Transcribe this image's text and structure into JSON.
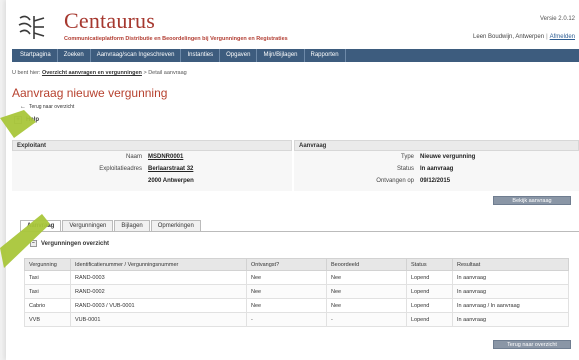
{
  "header": {
    "brand": "Centaurus",
    "tagline": "Communicatieplatform Distributie en Beoordelingen bij Vergunningen en Registraties",
    "version": "Versie 2.0.12",
    "user": "Leen Boudwijn, Antwerpen",
    "logout": "Afmelden"
  },
  "nav": {
    "items": [
      "Startpagina",
      "Zoeken",
      "Aanvraag/scan Ingeschreven",
      "Instanties",
      "Opgaven",
      "Mijn/Bijlagen",
      "Rapporten"
    ]
  },
  "breadcrumb": {
    "prefix": "U bent hier:",
    "link": "Overzicht aanvragen en vergunningen",
    "current": "> Detail aanvraag"
  },
  "page": {
    "title": "Aanvraag nieuwe vergunning",
    "back_link": "Terug naar overzicht",
    "help": "Help"
  },
  "exploitant": {
    "heading": "Exploitant",
    "fields": [
      {
        "key": "Naam",
        "value": "MSDNR0001"
      },
      {
        "key": "Exploitatieadres",
        "value": "Berlaarstraat 32"
      },
      {
        "key": "",
        "value": "2000 Antwerpen"
      }
    ]
  },
  "aanvraag": {
    "heading": "Aanvraag",
    "fields": [
      {
        "key": "Type",
        "value": "Nieuwe vergunning"
      },
      {
        "key": "Status",
        "value": "In aanvraag"
      },
      {
        "key": "Ontvangen op",
        "value": "09/12/2015"
      }
    ],
    "button": "Bekijk aanvraag"
  },
  "tabs": [
    "Aanvraag",
    "Vergunningen",
    "Bijlagen",
    "Opmerkingen"
  ],
  "section": {
    "title": "Vergunningen overzicht"
  },
  "table": {
    "columns": [
      "Vergunning",
      "Identificatienummer / Vergunningsnummer",
      "Ontvangst?",
      "Beoordeeld",
      "Status",
      "Resultaat"
    ],
    "rows": [
      [
        "Taxi",
        "RAND-0003",
        "Nee",
        "Nee",
        "Lopend",
        "In aanvraag"
      ],
      [
        "Taxi",
        "RAND-0002",
        "Nee",
        "Nee",
        "Lopend",
        "In aanvraag"
      ],
      [
        "Cabrio",
        "RAND-0003 / VUB-0001",
        "Nee",
        "Nee",
        "Lopend",
        "In aanvraag / In aanvraag"
      ],
      [
        "VVB",
        "VUB-0001",
        "-",
        "-",
        "Lopend",
        "In aanvraag"
      ]
    ],
    "button": "Terug naar overzicht"
  },
  "colors": {
    "brand": "#a6382f",
    "nav": "#3d5c7e",
    "title": "#b7422f",
    "highlight": "#a9c63a"
  }
}
